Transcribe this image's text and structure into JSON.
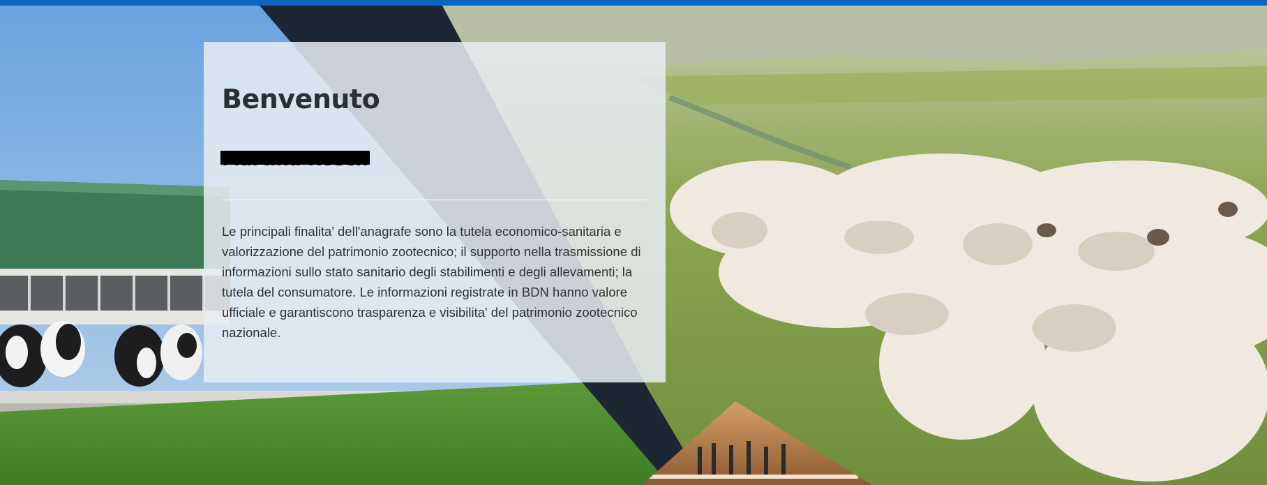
{
  "hero": {
    "title": "Benvenuto",
    "user_name": "Martina Rosch",
    "description": "Le principali finalita' dell'anagrafe sono la tutela economico-sanitaria e valorizzazione del patrimonio zootecnico; il supporto nella trasmissione di informazioni sullo stato sanitario degli stabilimenti e degli allevamenti; la tutela del consumatore. Le informazioni registrate in BDN hanno valore ufficiale e garantiscono trasparenza e visibilita' del patrimonio zootecnico nazionale."
  },
  "colors": {
    "top_bar": "#0a66c2",
    "dark_band": "#1c2733",
    "card_bg": "#e8ecf2"
  },
  "images": {
    "left": "cow-barn-photo",
    "right": "sheep-flock-photo",
    "bottom": "people-hall-photo"
  }
}
